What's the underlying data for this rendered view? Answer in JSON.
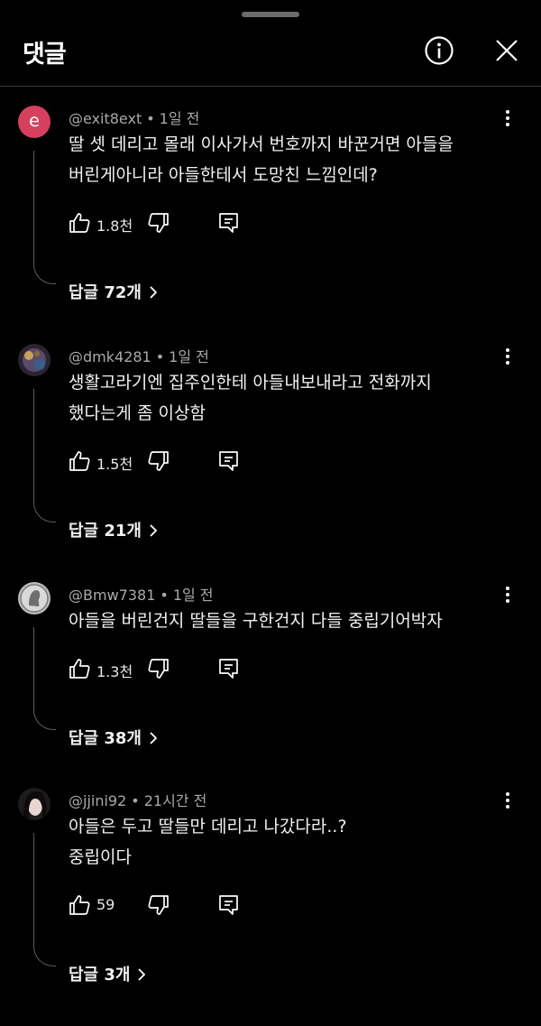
{
  "header": {
    "title": "댓글",
    "info_icon": "info-icon",
    "close_icon": "close-icon"
  },
  "comments": [
    {
      "avatar_letter": "e",
      "avatar_color": "#d6405f",
      "handle": "@exit8ext",
      "time": "1일 전",
      "lines": [
        "딸 셋 데리고 몰래 이사가서 번호까지 바꾼거면 아들을",
        "버린게아니라 아들한테서 도망친 느낌인데?"
      ],
      "likes": "1.8천",
      "replies": "답글 72개"
    },
    {
      "avatar_letter": "",
      "handle": "@dmk4281",
      "time": "1일 전",
      "lines": [
        "생활고라기엔 집주인한테 아들내보내라고 전화까지",
        "했다는게 좀 이상함"
      ],
      "likes": "1.5천",
      "replies": "답글 21개"
    },
    {
      "avatar_letter": "",
      "handle": "@Bmw7381",
      "time": "1일 전",
      "lines": [
        "아들을 버린건지 딸들을 구한건지 다들 중립기어박자"
      ],
      "likes": "1.3천",
      "replies": "답글 38개"
    },
    {
      "avatar_letter": "",
      "handle": "@jjini92",
      "time": "21시간 전",
      "lines": [
        "아들은 두고 딸들만 데리고 나갔다라..?",
        "중립이다"
      ],
      "likes": "59",
      "replies": "답글 3개"
    }
  ]
}
